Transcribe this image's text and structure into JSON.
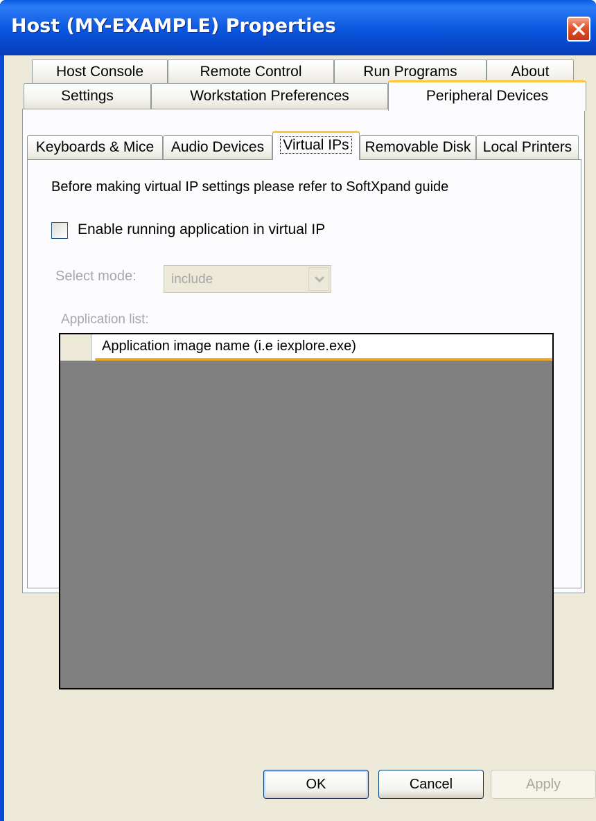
{
  "window": {
    "title": "Host (MY-EXAMPLE) Properties"
  },
  "tabs": {
    "row_back": [
      "Host Console",
      "Remote Control",
      "Run Programs",
      "About"
    ],
    "row_front": [
      "Settings",
      "Workstation Preferences",
      "Peripheral Devices"
    ],
    "active": "Peripheral Devices"
  },
  "subtabs": {
    "items": [
      "Keyboards & Mice",
      "Audio Devices",
      "Virtual IPs",
      "Removable Disk",
      "Local Printers"
    ],
    "active": "Virtual IPs"
  },
  "panel": {
    "info": "Before making virtual IP settings please refer to SoftXpand guide",
    "enable_checkbox_label": "Enable running application in virtual IP",
    "enable_checked": false,
    "select_mode_label": "Select mode:",
    "select_mode_value": "include",
    "application_list_label": "Application list:",
    "grid_column_header": "Application image name (i.e  iexplore.exe)"
  },
  "buttons": {
    "ok": "OK",
    "cancel": "Cancel",
    "apply": "Apply"
  },
  "colors": {
    "titlebar": "#0b56de",
    "dialog_bg": "#ece9d8",
    "tab_highlight": "#ffc83c",
    "grid_bg": "#808080"
  }
}
